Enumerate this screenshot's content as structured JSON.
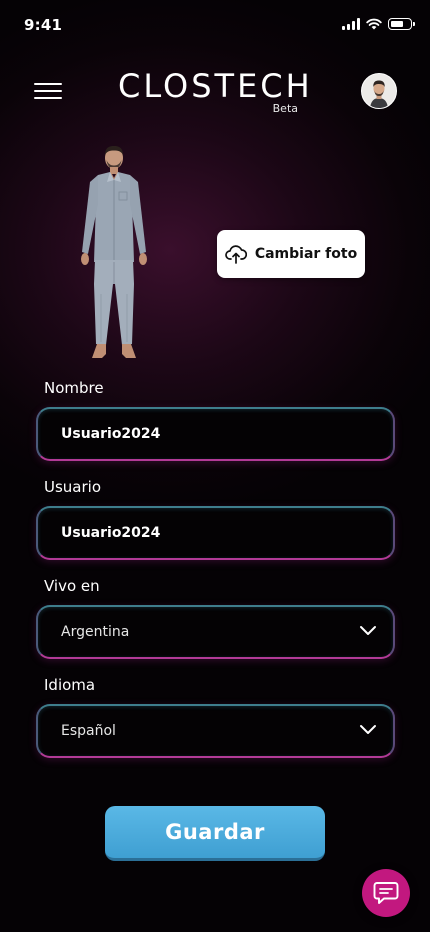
{
  "status_bar": {
    "time": "9:41"
  },
  "header": {
    "logo_text": "CLOSTECH",
    "logo_badge": "Beta",
    "menu_icon": "hamburger-menu-icon",
    "avatar_icon": "user-avatar"
  },
  "profile": {
    "change_photo_label": "Cambiar foto",
    "change_photo_icon": "cloud-upload-icon"
  },
  "form": {
    "name": {
      "label": "Nombre",
      "value": "Usuario2024"
    },
    "username": {
      "label": "Usuario",
      "value": "Usuario2024"
    },
    "location": {
      "label": "Vivo en",
      "value": "Argentina"
    },
    "language": {
      "label": "Idioma",
      "value": "Español"
    }
  },
  "actions": {
    "save_label": "Guardar"
  },
  "chat": {
    "icon": "chat-bubble-icon"
  },
  "colors": {
    "save_button": "#4aaddd",
    "chat_button": "#c2187f",
    "field_border_top": "#3e7d8c",
    "field_border_bottom": "#b23a96"
  }
}
